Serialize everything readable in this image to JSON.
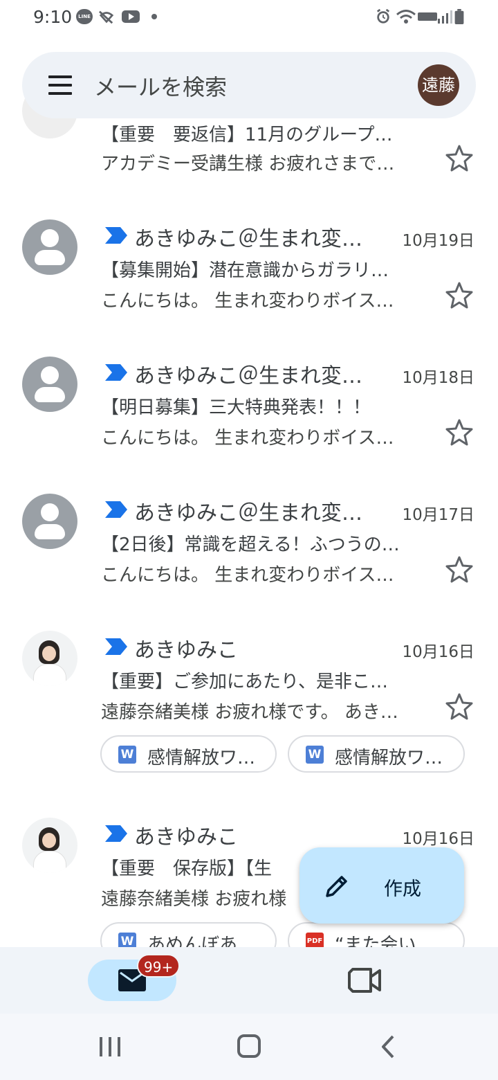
{
  "status_bar": {
    "time": "9:10",
    "line_icon_text": "LINE"
  },
  "search": {
    "placeholder": "メールを検索",
    "avatar_text": "遠藤"
  },
  "emails": [
    {
      "subject": "【重要　要返信】11月のグループ…",
      "snippet": "アカデミー受講生様 お疲れさまで…"
    },
    {
      "sender": "あきゆみこ＠生まれ変…",
      "date": "10月19日",
      "subject": "【募集開始】潜在意識からガラリ…",
      "snippet": "こんにちは。 生まれ変わりボイス…"
    },
    {
      "sender": "あきゆみこ＠生まれ変…",
      "date": "10月18日",
      "subject": "【明日募集】三大特典発表！！！",
      "snippet": "こんにちは。 生まれ変わりボイス…"
    },
    {
      "sender": "あきゆみこ＠生まれ変…",
      "date": "10月17日",
      "subject": "【2日後】常識を超える！ふつうの…",
      "snippet": "こんにちは。 生まれ変わりボイス…"
    },
    {
      "sender": "あきゆみこ",
      "date": "10月16日",
      "subject": "【重要】ご参加にあたり、是非こ…",
      "snippet": "遠藤奈緒美様 お疲れ様です。 あき…",
      "attachments": [
        {
          "type": "W",
          "label": "感情解放ワ…"
        },
        {
          "type": "W",
          "label": "感情解放ワ…"
        }
      ]
    },
    {
      "sender": "あきゆみこ",
      "date": "10月16日",
      "subject": "【重要　保存版】【生",
      "snippet": "遠藤奈緒美様 お疲れ様",
      "attachments": [
        {
          "type": "W",
          "label": "あめんぼあ…"
        },
        {
          "type": "PDF",
          "label": "“また会い…"
        }
      ]
    }
  ],
  "fab": {
    "label": "作成"
  },
  "bottom_nav": {
    "badge": "99+"
  },
  "colors": {
    "importance_marker": "#1a73e8",
    "fab_bg": "#c2e7ff",
    "badge_bg": "#b3261e"
  }
}
